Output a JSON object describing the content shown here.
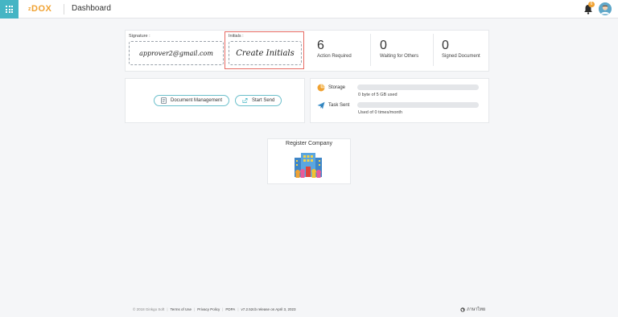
{
  "header": {
    "logo_prefix": "z",
    "logo_main": "DOX",
    "title": "Dashboard",
    "notification_count": "6"
  },
  "signature": {
    "label": "Signature :",
    "value": "approver2@gmail.com"
  },
  "initials": {
    "label": "Initials :",
    "value": "Create Initials"
  },
  "stats": [
    {
      "value": "6",
      "label": "Action Required"
    },
    {
      "value": "0",
      "label": "Waiting for Others"
    },
    {
      "value": "0",
      "label": "Signed Document"
    }
  ],
  "actions": {
    "document_management": "Document Management",
    "start_send": "Start Send"
  },
  "storage": {
    "label": "Storage",
    "usage": "0 byte of 5 GB used",
    "fraction_used": 0
  },
  "task_sent": {
    "label": "Task Sent",
    "usage": "Used of 0 times/month",
    "fraction_used": 0
  },
  "register": {
    "title": "Register Company"
  },
  "footer": {
    "copyright": "© 2018 Ginkgo Soft",
    "terms": "Terms of Use",
    "privacy": "Privacy Policy",
    "pdpa": "PDPA",
    "version": "v7.2.52cb release on April 3, 2023",
    "language": "ภาษาไทย"
  },
  "colors": {
    "accent": "#45b5c4",
    "brand": "#f0a232",
    "highlight_border": "#e66a62"
  }
}
